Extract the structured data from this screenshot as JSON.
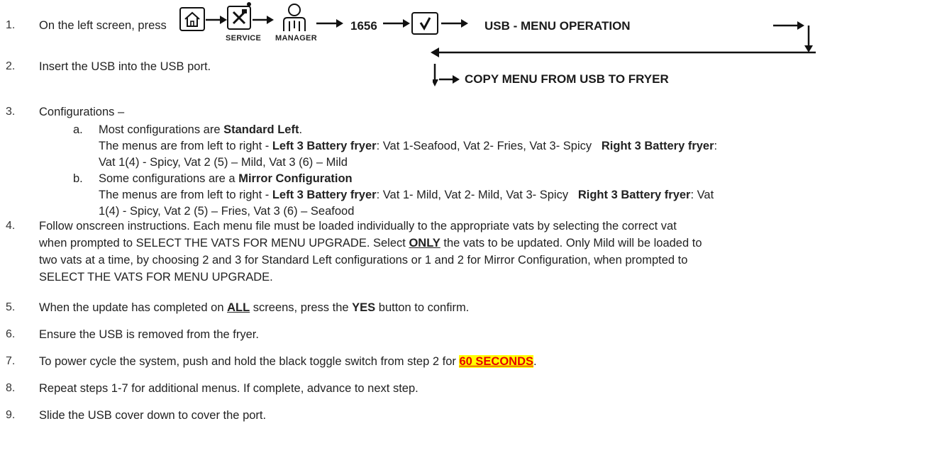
{
  "steps": {
    "s1": {
      "num": "1.",
      "text": "On the left screen, press"
    },
    "s2": {
      "num": "2.",
      "text": "Insert the USB into the USB port."
    },
    "s3": {
      "num": "3.",
      "text": "Configurations –"
    },
    "s3a": {
      "letter": "a.",
      "line1_pre": "Most configurations are ",
      "line1_bold": "Standard Left",
      "line1_post": ".",
      "line2_pre": "The menus are from left to right - ",
      "line2_b1": "Left 3 Battery fryer",
      "line2_mid": ": Vat 1-Seafood, Vat 2- Fries, Vat 3- Spicy   ",
      "line2_b2": "Right 3 Battery fryer",
      "line2_post": ":",
      "line3": "Vat 1(4) - Spicy, Vat 2 (5) – Mild, Vat 3 (6) – Mild"
    },
    "s3b": {
      "letter": "b.",
      "line1_pre": "Some configurations are a ",
      "line1_bold": "Mirror Configuration",
      "line2_pre": "The menus are from left to right - ",
      "line2_b1": "Left 3 Battery fryer",
      "line2_mid": ": Vat 1- Mild, Vat 2- Mild, Vat 3- Spicy   ",
      "line2_b2": "Right 3 Battery fryer",
      "line2_post": ": Vat",
      "line3": "1(4) - Spicy, Vat 2 (5) – Fries, Vat 3 (6) – Seafood"
    },
    "s4": {
      "num": "4.",
      "line1": "Follow onscreen instructions.  Each menu file must be loaded individually to the appropriate vats by selecting the correct vat",
      "line2_pre": "when prompted to SELECT THE VATS FOR MENU UPGRADE.  Select ",
      "line2_ul": "ONLY",
      "line2_post": " the vats to be updated. Only Mild will be loaded to",
      "line3": "two vats at a time, by choosing 2 and 3 for Standard Left configurations or 1 and 2 for Mirror Configuration, when prompted to",
      "line4": "SELECT THE VATS FOR MENU UPGRADE."
    },
    "s5": {
      "num": "5.",
      "pre": "When the update has completed on ",
      "ul": "ALL",
      "mid": " screens, press the ",
      "bold": "YES",
      "post": " button to confirm."
    },
    "s6": {
      "num": "6.",
      "text": "Ensure the USB is removed from the fryer."
    },
    "s7": {
      "num": "7.",
      "pre": "To power cycle the system, push and hold the black toggle switch from step 2 for ",
      "hl": "60 SECONDS",
      "post": "."
    },
    "s8": {
      "num": "8.",
      "text": "Repeat steps 1-7 for additional menus.  If complete, advance to next step."
    },
    "s9": {
      "num": "9.",
      "text": "Slide the USB cover down to cover the port."
    }
  },
  "flow": {
    "service_label": "SERVICE",
    "manager_label": "MANAGER",
    "code": "1656",
    "usb_menu": "USB - MENU OPERATION",
    "copy_menu": "COPY MENU FROM USB TO FRYER"
  },
  "colors": {
    "highlight_bg": "#ffff00",
    "highlight_text": "#e60000"
  }
}
